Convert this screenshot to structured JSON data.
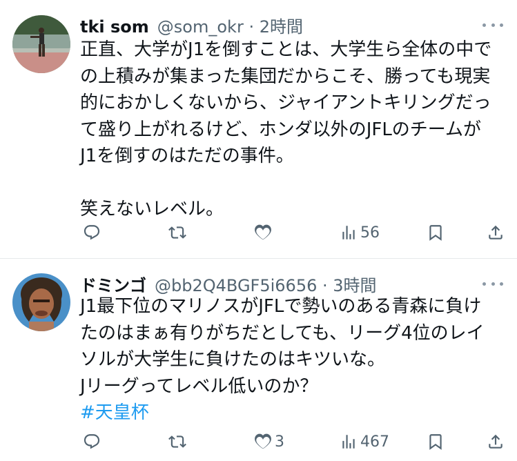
{
  "tweets": [
    {
      "name": "tki som",
      "handle": "@som_okr · 2時間",
      "lines": [
        "正直、大学がJ1を倒すことは、大学生ら全体の中で",
        "の上積みが集まった集団だからこそ、勝っても現実",
        "的におかしくないから、ジャイアントキリングだっ",
        "て盛り上がれるけど、ホンダ以外のJFLのチームが",
        "J1を倒すのはただの事件。",
        "",
        "笑えないレベル。"
      ],
      "reply_count": "",
      "retweet_count": "",
      "like_count": "",
      "view_count": "56"
    },
    {
      "name": "ドミンゴ",
      "handle": "@bb2Q4BGF5i6656 · 3時間",
      "lines": [
        "J1最下位のマリノスがJFLで勢いのある青森に負け",
        "たのはまぁ有りがちだとしても、リーグ4位のレイ",
        "ソルが大学生に負けたのはキツいな。",
        "Jリーグってレベル低いのか？"
      ],
      "hashtag": "#天皇杯",
      "reply_count": "",
      "retweet_count": "",
      "like_count": "3",
      "view_count": "467"
    }
  ],
  "icons": {
    "avatar1": "tennis-player-avatar",
    "avatar2": "person-avatar",
    "reply": "reply-icon",
    "retweet": "retweet-icon",
    "like": "heart-icon",
    "views": "views-icon",
    "bookmark": "bookmark-icon",
    "share": "share-icon",
    "more": "more-icon"
  },
  "colors": {
    "text": "#0f1419",
    "secondary": "#536471",
    "link": "#1d9bf0",
    "divider": "#e6e9eb"
  }
}
